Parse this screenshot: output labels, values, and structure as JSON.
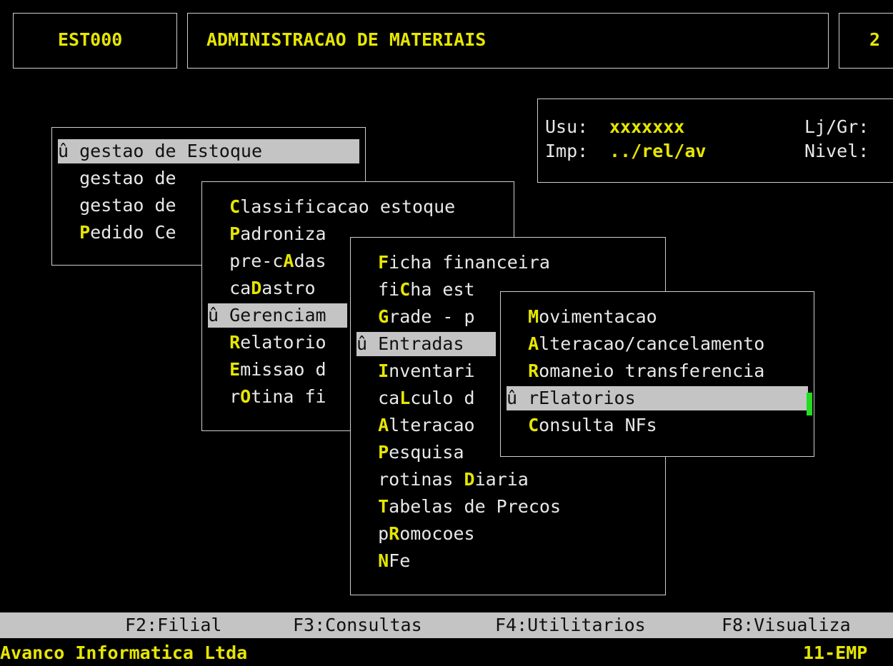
{
  "header": {
    "code": "EST000",
    "title": "ADMINISTRACAO DE MATERIAIS",
    "right_fragment": "2"
  },
  "user_panel": {
    "usu_label": "Usu:",
    "usu_value": "xxxxxxx",
    "imp_label": "Imp:",
    "imp_value": "../rel/av",
    "ljgr_label": "Lj/Gr:",
    "nivel_label": "Nivel:"
  },
  "menu1": {
    "items": [
      {
        "prefix": "û ",
        "pre": "gestao de ",
        "hot": "E",
        "post": "stoque"
      },
      {
        "prefix": "  ",
        "pre": "gestao de",
        "hot": "",
        "post": ""
      },
      {
        "prefix": "  ",
        "pre": "gestao de",
        "hot": "",
        "post": ""
      },
      {
        "prefix": "  ",
        "pre": "",
        "hot": "P",
        "post": "edido Ce"
      }
    ]
  },
  "menu2": {
    "items": [
      {
        "prefix": "  ",
        "pre": "",
        "hot": "C",
        "post": "lassificacao estoque"
      },
      {
        "prefix": "  ",
        "pre": "",
        "hot": "P",
        "post": "adroniza"
      },
      {
        "prefix": "  ",
        "pre": "pre-c",
        "hot": "A",
        "post": "das"
      },
      {
        "prefix": "  ",
        "pre": "ca",
        "hot": "D",
        "post": "astro"
      },
      {
        "prefix": "û ",
        "pre": "",
        "hot": "G",
        "post": "erenciam"
      },
      {
        "prefix": "  ",
        "pre": "",
        "hot": "R",
        "post": "elatorio"
      },
      {
        "prefix": "  ",
        "pre": "",
        "hot": "E",
        "post": "missao d"
      },
      {
        "prefix": "  ",
        "pre": "r",
        "hot": "O",
        "post": "tina fi"
      }
    ]
  },
  "menu3": {
    "items": [
      {
        "prefix": "  ",
        "pre": "",
        "hot": "F",
        "post": "icha financeira"
      },
      {
        "prefix": "  ",
        "pre": "fi",
        "hot": "C",
        "post": "ha est"
      },
      {
        "prefix": "  ",
        "pre": "",
        "hot": "G",
        "post": "rade - p"
      },
      {
        "prefix": "û ",
        "pre": "",
        "hot": "E",
        "post": "ntradas"
      },
      {
        "prefix": "  ",
        "pre": "",
        "hot": "I",
        "post": "nventari"
      },
      {
        "prefix": "  ",
        "pre": "ca",
        "hot": "L",
        "post": "culo d"
      },
      {
        "prefix": "  ",
        "pre": "",
        "hot": "A",
        "post": "lteracao"
      },
      {
        "prefix": "  ",
        "pre": "",
        "hot": "P",
        "post": "esquisa"
      },
      {
        "prefix": "  ",
        "pre": "rotinas ",
        "hot": "D",
        "post": "iaria"
      },
      {
        "prefix": "  ",
        "pre": "",
        "hot": "T",
        "post": "abelas de Precos"
      },
      {
        "prefix": "  ",
        "pre": "p",
        "hot": "R",
        "post": "omocoes"
      },
      {
        "prefix": "  ",
        "pre": "",
        "hot": "N",
        "post": "Fe"
      }
    ]
  },
  "menu4": {
    "items": [
      {
        "prefix": "  ",
        "pre": "",
        "hot": "M",
        "post": "ovimentacao"
      },
      {
        "prefix": "  ",
        "pre": "",
        "hot": "A",
        "post": "lteracao/cancelamento"
      },
      {
        "prefix": "  ",
        "pre": "",
        "hot": "R",
        "post": "omaneio transferencia"
      },
      {
        "prefix": "û ",
        "pre": "r",
        "hot": "E",
        "post": "latorios"
      },
      {
        "prefix": "  ",
        "pre": "",
        "hot": "C",
        "post": "onsulta NFs"
      }
    ]
  },
  "function_bar": {
    "f2": "F2:Filial",
    "f3": "F3:Consultas",
    "f4": "F4:Utilitarios",
    "f8": "F8:Visualiza"
  },
  "status_bar": {
    "company": "Avanco Informatica Ltda",
    "emp": "11-EMP"
  },
  "colors": {
    "background": "#000000",
    "text": "#e8e8e8",
    "accent": "#e6e600",
    "selection": "#c4c4c4",
    "cursor": "#22dd22"
  }
}
